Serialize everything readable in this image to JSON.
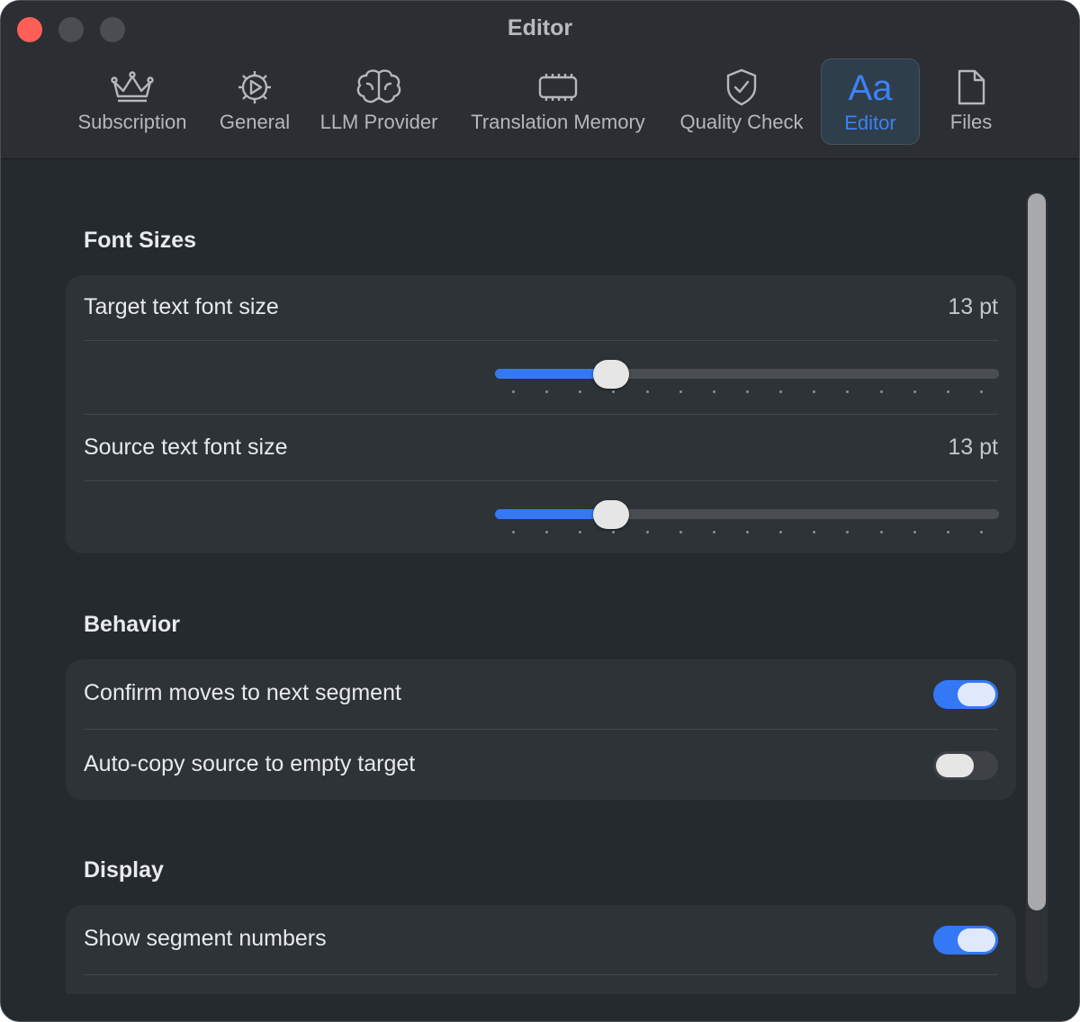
{
  "window": {
    "title": "Editor"
  },
  "tabs": [
    {
      "label": "Subscription",
      "icon": "crown-icon"
    },
    {
      "label": "General",
      "icon": "gear-icon"
    },
    {
      "label": "LLM Provider",
      "icon": "brain-icon"
    },
    {
      "label": "Translation Memory",
      "icon": "memory-chip-icon"
    },
    {
      "label": "Quality Check",
      "icon": "shield-check-icon"
    },
    {
      "label": "Editor",
      "icon": "text-aa-icon",
      "glyph": "Aa",
      "active": true
    },
    {
      "label": "Files",
      "icon": "document-icon"
    }
  ],
  "font_sizes": {
    "title": "Font Sizes",
    "target": {
      "label": "Target text font size",
      "value": "13 pt",
      "level": 0.23
    },
    "source": {
      "label": "Source text font size",
      "value": "13 pt",
      "level": 0.23
    },
    "tick_count": 15
  },
  "behavior": {
    "title": "Behavior",
    "confirm": {
      "label": "Confirm moves to next segment",
      "on": true
    },
    "autocopy": {
      "label": "Auto-copy source to empty target",
      "on": false
    }
  },
  "display": {
    "title": "Display",
    "segment_numbers": {
      "label": "Show segment numbers",
      "on": true
    }
  },
  "colors": {
    "accent": "#3478f6",
    "background": "#252a2e",
    "card": "#2e3337"
  }
}
